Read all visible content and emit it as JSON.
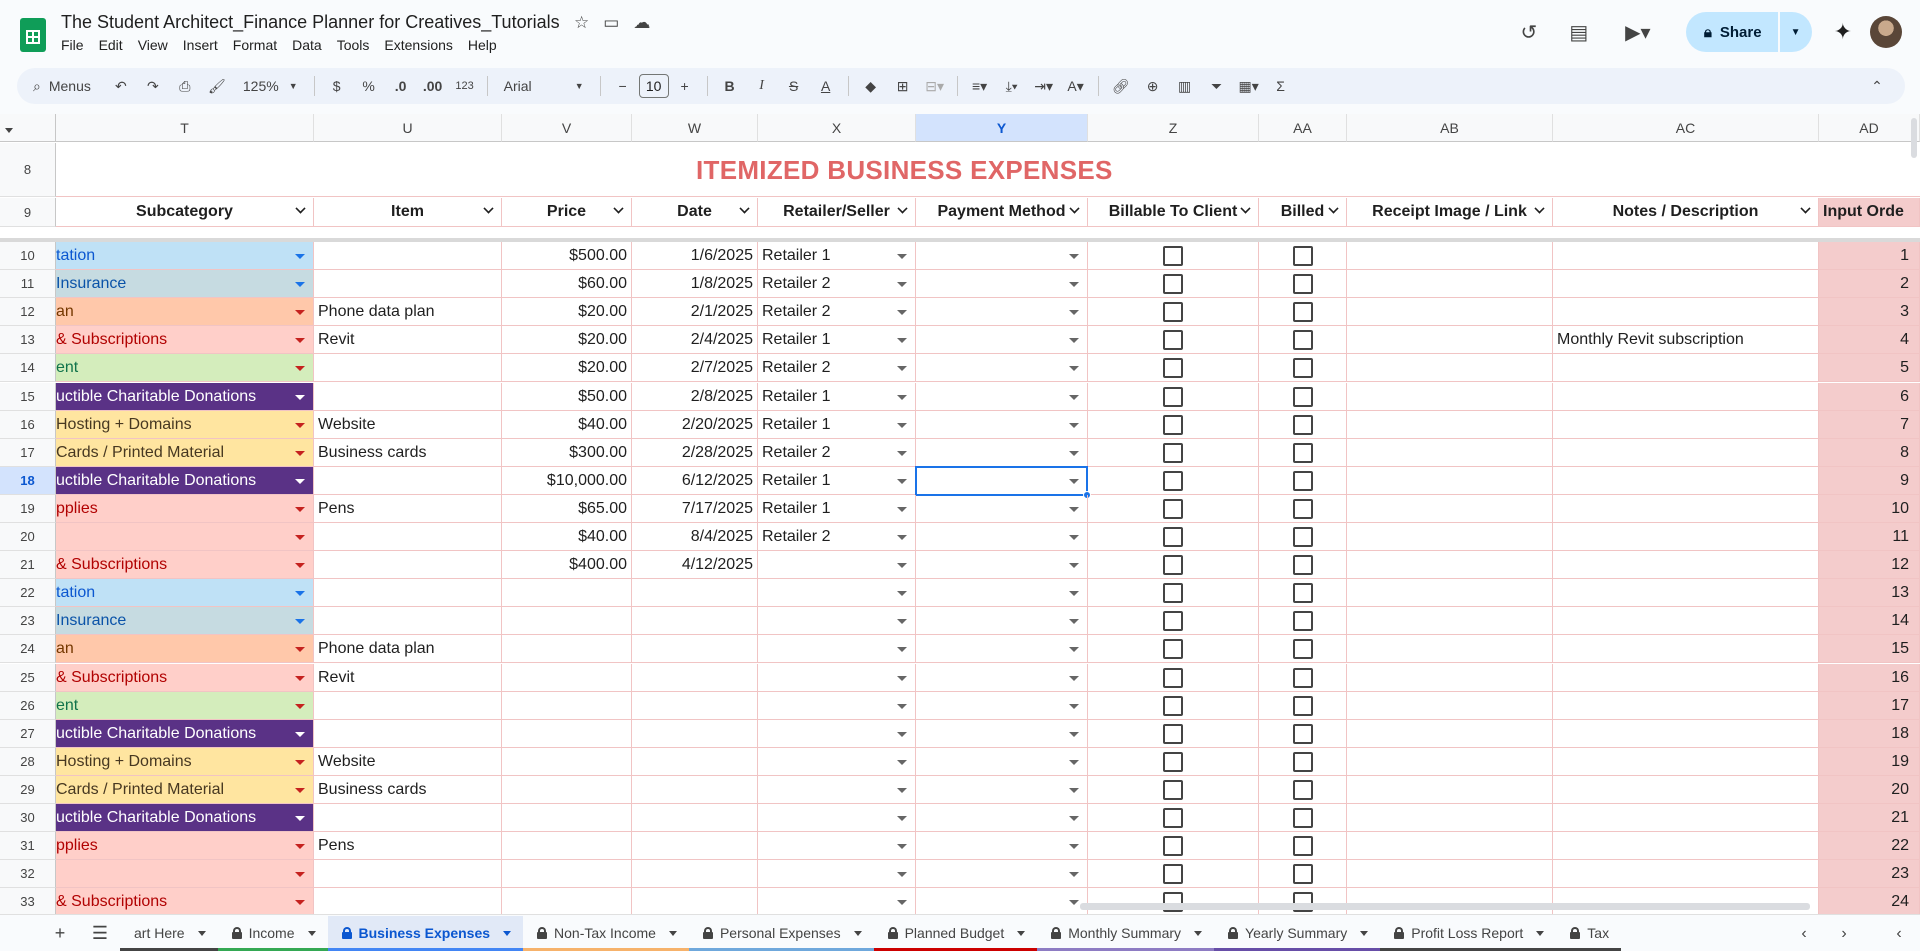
{
  "app": {
    "doc_title": "The Student Architect_Finance Planner for Creatives_Tutorials",
    "menus": [
      "File",
      "Edit",
      "View",
      "Insert",
      "Format",
      "Data",
      "Tools",
      "Extensions",
      "Help"
    ],
    "share_label": "Share"
  },
  "toolbar": {
    "menus_label": "Menus",
    "zoom": "125%",
    "currency": "$",
    "percent": "%",
    "dec_decrease": ".0",
    "dec_increase": ".00",
    "number_format": "123",
    "font": "Arial",
    "font_size": "10"
  },
  "sheet": {
    "columns": [
      "T",
      "U",
      "V",
      "W",
      "X",
      "Y",
      "Z",
      "AA",
      "AB",
      "AC",
      "AD"
    ],
    "selected_column": "Y",
    "banner_title": "ITEMIZED BUSINESS EXPENSES",
    "headers": [
      "Subcategory",
      "Item",
      "Price",
      "Date",
      "Retailer/Seller",
      "Payment Method",
      "Billable To Client",
      "Billed",
      "Receipt Image / Link",
      "Notes / Description",
      "Input Orde"
    ],
    "header_row_labels": [
      "8",
      "9"
    ],
    "selected_row": "18",
    "rows": [
      {
        "row": "10",
        "sub": "tation",
        "sub_color": "blue",
        "item": "",
        "price": "$500.00",
        "date": "1/6/2025",
        "retailer": "Retailer 1",
        "notes": "",
        "order": "1"
      },
      {
        "row": "11",
        "sub": " Insurance",
        "sub_color": "teal",
        "item": "",
        "price": "$60.00",
        "date": "1/8/2025",
        "retailer": "Retailer 2",
        "notes": "",
        "order": "2"
      },
      {
        "row": "12",
        "sub": "an",
        "sub_color": "orange",
        "item": "Phone data plan",
        "price": "$20.00",
        "date": "2/1/2025",
        "retailer": "Retailer 2",
        "notes": "",
        "order": "3"
      },
      {
        "row": "13",
        "sub": " & Subscriptions",
        "sub_color": "pink",
        "item": "Revit",
        "price": "$20.00",
        "date": "2/4/2025",
        "retailer": "Retailer 1",
        "notes": "Monthly Revit subscription",
        "order": "4"
      },
      {
        "row": "14",
        "sub": "ent",
        "sub_color": "green",
        "item": "",
        "price": "$20.00",
        "date": "2/7/2025",
        "retailer": "Retailer 2",
        "notes": "",
        "order": "5"
      },
      {
        "row": "15",
        "sub": "uctible Charitable Donations",
        "sub_color": "purple",
        "item": "",
        "price": "$50.00",
        "date": "2/8/2025",
        "retailer": "Retailer 1",
        "notes": "",
        "order": "6"
      },
      {
        "row": "16",
        "sub": "Hosting + Domains",
        "sub_color": "yellow",
        "item": "Website",
        "price": "$40.00",
        "date": "2/20/2025",
        "retailer": "Retailer 1",
        "notes": "",
        "order": "7"
      },
      {
        "row": "17",
        "sub": " Cards / Printed Material",
        "sub_color": "yellow",
        "item": "Business cards",
        "price": "$300.00",
        "date": "2/28/2025",
        "retailer": "Retailer 2",
        "notes": "",
        "order": "8"
      },
      {
        "row": "18",
        "sub": "uctible Charitable Donations",
        "sub_color": "purple",
        "item": "",
        "price": "$10,000.00",
        "date": "6/12/2025",
        "retailer": "Retailer 1",
        "notes": "",
        "order": "9"
      },
      {
        "row": "19",
        "sub": "pplies",
        "sub_color": "pink",
        "item": "Pens",
        "price": "$65.00",
        "date": "7/17/2025",
        "retailer": "Retailer 1",
        "notes": "",
        "order": "10"
      },
      {
        "row": "20",
        "sub": "",
        "sub_color": "pink",
        "item": "",
        "price": "$40.00",
        "date": "8/4/2025",
        "retailer": "Retailer 2",
        "notes": "",
        "order": "11"
      },
      {
        "row": "21",
        "sub": " & Subscriptions",
        "sub_color": "pink",
        "item": "",
        "price": "$400.00",
        "date": "4/12/2025",
        "retailer": "",
        "notes": "",
        "order": "12"
      },
      {
        "row": "22",
        "sub": "tation",
        "sub_color": "blue",
        "item": "",
        "price": "",
        "date": "",
        "retailer": "",
        "notes": "",
        "order": "13"
      },
      {
        "row": "23",
        "sub": " Insurance",
        "sub_color": "teal",
        "item": "",
        "price": "",
        "date": "",
        "retailer": "",
        "notes": "",
        "order": "14"
      },
      {
        "row": "24",
        "sub": "an",
        "sub_color": "orange",
        "item": "Phone data plan",
        "price": "",
        "date": "",
        "retailer": "",
        "notes": "",
        "order": "15"
      },
      {
        "row": "25",
        "sub": " & Subscriptions",
        "sub_color": "pink",
        "item": "Revit",
        "price": "",
        "date": "",
        "retailer": "",
        "notes": "",
        "order": "16"
      },
      {
        "row": "26",
        "sub": "ent",
        "sub_color": "green",
        "item": "",
        "price": "",
        "date": "",
        "retailer": "",
        "notes": "",
        "order": "17"
      },
      {
        "row": "27",
        "sub": "uctible Charitable Donations",
        "sub_color": "purple",
        "item": "",
        "price": "",
        "date": "",
        "retailer": "",
        "notes": "",
        "order": "18"
      },
      {
        "row": "28",
        "sub": "Hosting + Domains",
        "sub_color": "yellow",
        "item": "Website",
        "price": "",
        "date": "",
        "retailer": "",
        "notes": "",
        "order": "19"
      },
      {
        "row": "29",
        "sub": " Cards / Printed Material",
        "sub_color": "yellow",
        "item": "Business cards",
        "price": "",
        "date": "",
        "retailer": "",
        "notes": "",
        "order": "20"
      },
      {
        "row": "30",
        "sub": "uctible Charitable Donations",
        "sub_color": "purple",
        "item": "",
        "price": "",
        "date": "",
        "retailer": "",
        "notes": "",
        "order": "21"
      },
      {
        "row": "31",
        "sub": "pplies",
        "sub_color": "pink",
        "item": "Pens",
        "price": "",
        "date": "",
        "retailer": "",
        "notes": "",
        "order": "22"
      },
      {
        "row": "32",
        "sub": "",
        "sub_color": "pink",
        "item": "",
        "price": "",
        "date": "",
        "retailer": "",
        "notes": "",
        "order": "23"
      },
      {
        "row": "33",
        "sub": " & Subscriptions",
        "sub_color": "pink",
        "item": "",
        "price": "",
        "date": "",
        "retailer": "",
        "notes": "",
        "order": "24"
      }
    ]
  },
  "subcategory_colors": {
    "blue": {
      "bg": "#bfe1f6",
      "fg": "#0b57d0"
    },
    "teal": {
      "bg": "#c6dbe1",
      "fg": "#0a53a8"
    },
    "orange": {
      "bg": "#ffc8aa",
      "fg": "#753800"
    },
    "pink": {
      "bg": "#ffcfc9",
      "fg": "#b10202"
    },
    "green": {
      "bg": "#d4edbc",
      "fg": "#11734b"
    },
    "purple": {
      "bg": "#5a3286",
      "fg": "#ffffff"
    },
    "yellow": {
      "bg": "#ffe5a0",
      "fg": "#473821"
    }
  },
  "colors": {
    "banner_title": "#e06666",
    "order_bg": "#f4cccc",
    "grid_line": "#f1c4c4",
    "selection": "#1a73e8"
  },
  "tabs": [
    {
      "label": "art Here",
      "locked": false,
      "active": false,
      "color": "#444444"
    },
    {
      "label": "Income",
      "locked": true,
      "active": false,
      "color": "#34a853"
    },
    {
      "label": "Business Expenses",
      "locked": true,
      "active": true,
      "color": "#4285f4"
    },
    {
      "label": "Non-Tax Income",
      "locked": true,
      "active": false,
      "color": "#f6b26b"
    },
    {
      "label": "Personal Expenses",
      "locked": true,
      "active": false,
      "color": "#6fa8dc"
    },
    {
      "label": "Planned Budget",
      "locked": true,
      "active": false,
      "color": "#cc0000"
    },
    {
      "label": "Monthly Summary",
      "locked": true,
      "active": false,
      "color": "#8e7cc3"
    },
    {
      "label": "Yearly Summary",
      "locked": true,
      "active": false,
      "color": "#674ea7"
    },
    {
      "label": "Profit Loss Report",
      "locked": true,
      "active": false,
      "color": "#444444"
    },
    {
      "label": "Tax",
      "locked": true,
      "active": false,
      "color": "#444444"
    }
  ]
}
